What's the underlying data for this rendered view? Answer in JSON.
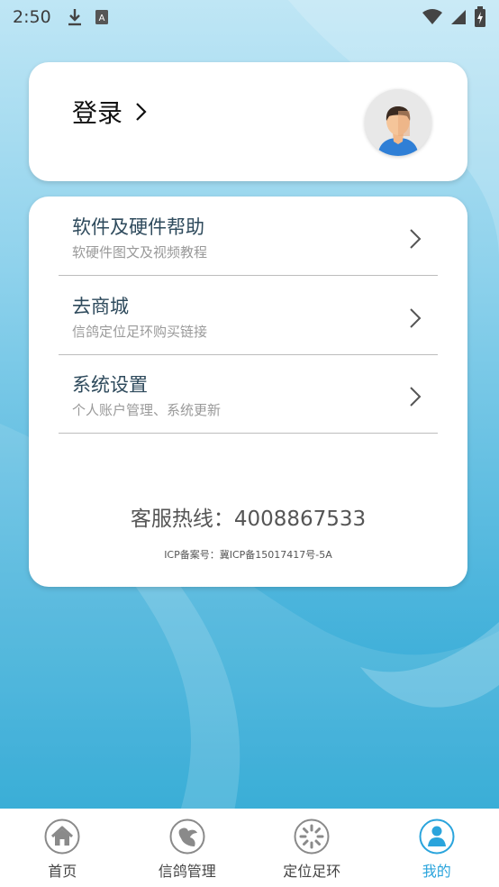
{
  "status_bar": {
    "time": "2:50",
    "left_icons": [
      "download-icon",
      "keyboard-a-icon"
    ],
    "right_icons": [
      "wifi-icon",
      "signal-icon",
      "battery-charging-icon"
    ]
  },
  "login_card": {
    "label": "登录",
    "avatar_icon": "user-avatar-icon"
  },
  "menu": {
    "items": [
      {
        "title": "软件及硬件帮助",
        "subtitle": "软硬件图文及视频教程"
      },
      {
        "title": "去商城",
        "subtitle": "信鸽定位足环购买链接"
      },
      {
        "title": "系统设置",
        "subtitle": "个人账户管理、系统更新"
      }
    ],
    "hotline": "客服热线：4008867533",
    "icp": "ICP备案号：冀ICP备15017417号-5A"
  },
  "bottom_nav": {
    "items": [
      {
        "label": "首页",
        "icon": "home-icon",
        "active": false
      },
      {
        "label": "信鸽管理",
        "icon": "pigeon-icon",
        "active": false
      },
      {
        "label": "定位足环",
        "icon": "locator-ring-icon",
        "active": false
      },
      {
        "label": "我的",
        "icon": "person-icon",
        "active": true
      }
    ]
  },
  "colors": {
    "accent": "#2aa4dc",
    "background_top": "#bfe6f5",
    "background_bottom": "#169fcf",
    "nav_icon_gray": "#8a8a8a"
  }
}
